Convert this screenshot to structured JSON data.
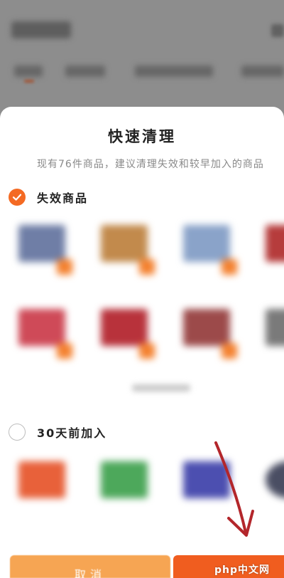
{
  "dialog": {
    "title": "快速清理",
    "subtitle": "现有76件商品，建议清理失效和较早加入的商品"
  },
  "sections": [
    {
      "label": "失效商品",
      "checked": true
    },
    {
      "label": "30天前加入",
      "checked": false
    }
  ],
  "footer": {
    "cancel_label": "取消"
  },
  "watermark": "php中文网",
  "colors": {
    "accent": "#f46a23",
    "cancel_bg": "#f6a553",
    "confirm_bg": "#f05d1f",
    "annotation_arrow": "#b3262b"
  }
}
